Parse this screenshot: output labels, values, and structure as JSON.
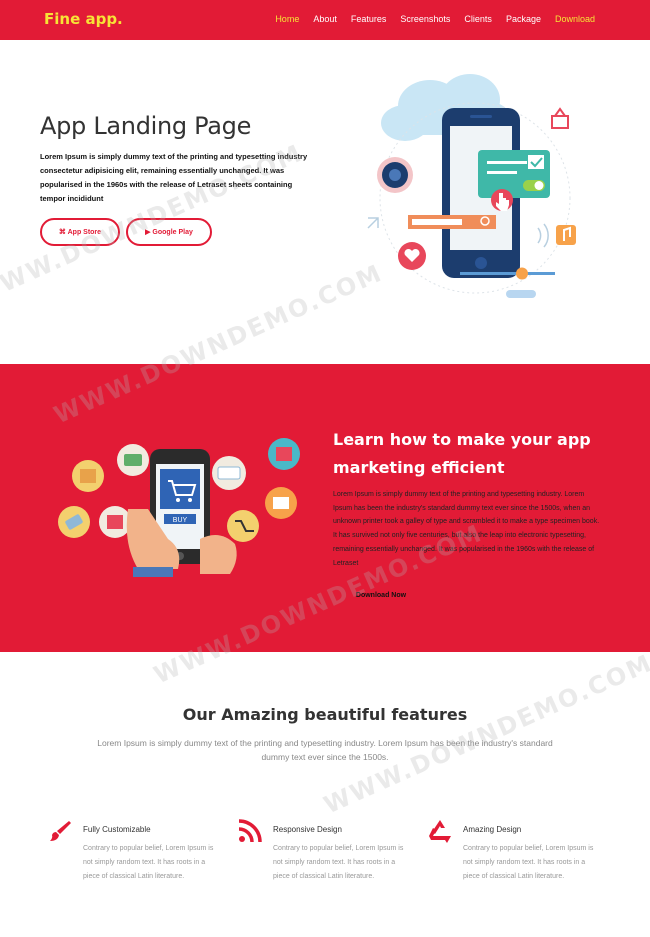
{
  "nav": {
    "logo": "Fine app.",
    "links": [
      "Home",
      "About",
      "Features",
      "Screenshots",
      "Clients",
      "Package",
      "Download"
    ]
  },
  "hero": {
    "title": "App Landing Page",
    "text": "Lorem Ipsum is simply dummy text of the printing and typesetting industry consectetur adipisicing elit, remaining essentially unchanged. It was popularised in the 1960s with the release of Letraset sheets containing tempor incididunt",
    "appstore_label": "⌘ App Store",
    "googleplay_label": "▶ Google Play"
  },
  "marketing": {
    "title": "Learn how to make your app marketing efficient",
    "text": "Lorem Ipsum is simply dummy text of the printing and typesetting industry. Lorem Ipsum has been the industry's standard dummy text ever since the 1500s, when an unknown printer took a galley of type and scrambled it to make a type specimen book. It has survived not only five centuries, but also the leap into electronic typesetting, remaining essentially unchanged. It was popularised in the 1960s with the release of Letraset",
    "button_label": "Download Now",
    "phone_button": "BUY"
  },
  "features": {
    "title": "Our Amazing beautiful features",
    "subtitle": "Lorem Ipsum is simply dummy text of the printing and typesetting industry. Lorem Ipsum has been the industry's standard dummy text ever since the 1500s.",
    "items": [
      {
        "name": "Fully Customizable",
        "desc": "Contrary to popular belief, Lorem Ipsum is not simply random text. It has roots in a piece of classical Latin literature.",
        "icon": "paintbrush-icon"
      },
      {
        "name": "Responsive Design",
        "desc": "Contrary to popular belief, Lorem Ipsum is not simply random text. It has roots in a piece of classical Latin literature.",
        "icon": "rss-icon"
      },
      {
        "name": "Amazing Design",
        "desc": "Contrary to popular belief, Lorem Ipsum is not simply random text. It has roots in a piece of classical Latin literature.",
        "icon": "recycle-icon"
      }
    ]
  },
  "watermark": "WWW.DOWNDEMO.COM",
  "colors": {
    "brand": "#e21b36",
    "logo": "#f7e436",
    "accent": "#f7e436"
  }
}
